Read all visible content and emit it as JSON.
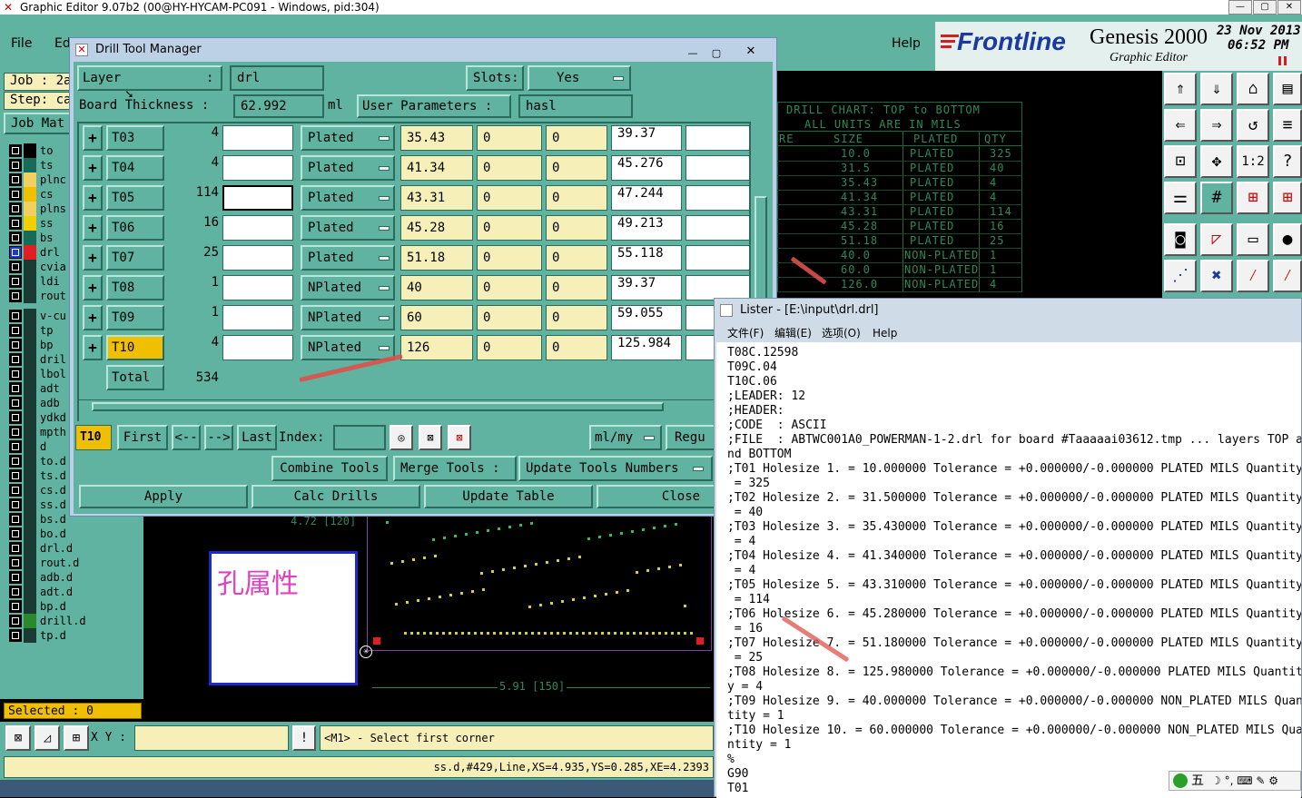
{
  "main_window": {
    "title": "Graphic Editor 9.07b2 (00@HY-HYCAM-PC091 - Windows, pid:304)",
    "menu_file": "File",
    "menu_edit": "Ed",
    "menu_help": "Help",
    "brand": "Frontline",
    "product": "Genesis 2000",
    "subproduct": "Graphic Editor",
    "date": "23 Nov 2013",
    "time": "06:52 PM",
    "job_label": "Job : 2a",
    "step_label": "Step: ca",
    "job_matrix": "Job Mat",
    "selected": "Selected : 0",
    "xy_label": "X Y :",
    "xy_value": "",
    "prompt_btn": "!",
    "prompt": "<M1> - Select first corner",
    "status": "ss.d,#429,Line,XS=4.935,YS=0.285,XE=4.2393"
  },
  "layers": [
    {
      "name": "to",
      "color": "#000000"
    },
    {
      "name": "ts",
      "color": "#1a6a5a"
    },
    {
      "name": "plnc",
      "color": "#f0d060"
    },
    {
      "name": "cs",
      "color": "#f0c000"
    },
    {
      "name": "plns",
      "color": "#f0d060"
    },
    {
      "name": "ss",
      "color": "#f0d000"
    },
    {
      "name": "bs",
      "color": "#1a6a5a"
    },
    {
      "name": "drl",
      "color": "#e02020"
    },
    {
      "name": "cvia",
      "color": "#1a3a34"
    },
    {
      "name": "ldi",
      "color": "#1a3a34"
    },
    {
      "name": "rout",
      "color": "#1a3a34"
    },
    {
      "name": "v-cu",
      "color": "#1a3a34"
    },
    {
      "name": "tp",
      "color": "#1a3a34"
    },
    {
      "name": "bp",
      "color": "#1a3a34"
    },
    {
      "name": "dril",
      "color": "#1a3a34"
    },
    {
      "name": "lbol",
      "color": "#1a3a34"
    },
    {
      "name": "adt",
      "color": "#1a3a34"
    },
    {
      "name": "adb",
      "color": "#1a3a34"
    },
    {
      "name": "ydkd",
      "color": "#1a3a34"
    },
    {
      "name": "mpth",
      "color": "#1a3a34"
    },
    {
      "name": "d",
      "color": "#1a3a34"
    },
    {
      "name": "to.d",
      "color": "#1a3a34"
    },
    {
      "name": "ts.d",
      "color": "#1a3a34"
    },
    {
      "name": "cs.d",
      "color": "#1a3a34"
    },
    {
      "name": "ss.d",
      "color": "#1a3a34"
    },
    {
      "name": "bs.d",
      "color": "#1a3a34"
    },
    {
      "name": "bo.d",
      "color": "#1a3a34"
    },
    {
      "name": "drl.d",
      "color": "#1a3a34"
    },
    {
      "name": "rout.d",
      "color": "#1a3a34"
    },
    {
      "name": "adb.d",
      "color": "#1a3a34"
    },
    {
      "name": "adt.d",
      "color": "#1a3a34"
    },
    {
      "name": "bp.d",
      "color": "#1a3a34"
    },
    {
      "name": "drill.d",
      "color": "#2a8a2a"
    },
    {
      "name": "tp.d",
      "color": "#1a3a34"
    }
  ],
  "dtm": {
    "title": "Drill Tool Manager",
    "layer_label": "Layer",
    "layer_colon": ":",
    "layer_value": "drl",
    "slots_label": "Slots:",
    "slots_value": "Yes",
    "thickness_label": "Board Thickness :",
    "thickness_value": "62.992",
    "thickness_unit": "ml",
    "user_params_label": "User Parameters :",
    "user_params_value": "hasl",
    "rows": [
      {
        "tool": "T03",
        "count": "4",
        "type": "Plated",
        "size": "35.43",
        "a": "0",
        "b": "0",
        "finish": "39.37"
      },
      {
        "tool": "T04",
        "count": "4",
        "type": "Plated",
        "size": "41.34",
        "a": "0",
        "b": "0",
        "finish": "45.276"
      },
      {
        "tool": "T05",
        "count": "114",
        "type": "Plated",
        "size": "43.31",
        "a": "0",
        "b": "0",
        "finish": "47.244"
      },
      {
        "tool": "T06",
        "count": "16",
        "type": "Plated",
        "size": "45.28",
        "a": "0",
        "b": "0",
        "finish": "49.213"
      },
      {
        "tool": "T07",
        "count": "25",
        "type": "Plated",
        "size": "51.18",
        "a": "0",
        "b": "0",
        "finish": "55.118"
      },
      {
        "tool": "T08",
        "count": "1",
        "type": "NPlated",
        "size": "40",
        "a": "0",
        "b": "0",
        "finish": "39.37"
      },
      {
        "tool": "T09",
        "count": "1",
        "type": "NPlated",
        "size": "60",
        "a": "0",
        "b": "0",
        "finish": "59.055"
      },
      {
        "tool": "T10",
        "count": "4",
        "type": "NPlated",
        "size": "126",
        "a": "0",
        "b": "0",
        "finish": "125.984"
      }
    ],
    "total_label": "Total",
    "total_value": "534",
    "current_tool": "T10",
    "first": "First",
    "prev": "<--",
    "next": "-->",
    "last": "Last",
    "index_label": "Index:",
    "units": "ml/my",
    "regular": "Regu",
    "combine": "Combine Tools",
    "merge": "Merge Tools :",
    "update_numbers": "Update Tools Numbers",
    "apply": "Apply",
    "calc": "Calc Drills",
    "update_table": "Update Table",
    "close": "Close"
  },
  "canvas": {
    "annotation": "孔属性",
    "dim_top": "4.72 [120]",
    "dim_bottom": "5.91 [150]"
  },
  "drill_chart": {
    "title": "DRILL CHART: TOP to BOTTOM",
    "subtitle": "ALL UNITS ARE IN MILS",
    "col0": "RE",
    "col_size": "SIZE",
    "col_plated": "PLATED",
    "col_qty": "QTY",
    "rows": [
      {
        "size": "10.0",
        "plated": "PLATED",
        "qty": "325"
      },
      {
        "size": "31.5",
        "plated": "PLATED",
        "qty": "40"
      },
      {
        "size": "35.43",
        "plated": "PLATED",
        "qty": "4"
      },
      {
        "size": "41.34",
        "plated": "PLATED",
        "qty": "4"
      },
      {
        "size": "43.31",
        "plated": "PLATED",
        "qty": "114"
      },
      {
        "size": "45.28",
        "plated": "PLATED",
        "qty": "16"
      },
      {
        "size": "51.18",
        "plated": "PLATED",
        "qty": "25"
      },
      {
        "size": "40.0",
        "plated": "NON-PLATED",
        "qty": "1"
      },
      {
        "size": "60.0",
        "plated": "NON-PLATED",
        "qty": "1"
      },
      {
        "size": "126.0",
        "plated": "NON-PLATED",
        "qty": "4"
      }
    ]
  },
  "lister": {
    "title": "Lister - [E:\\input\\drl.drl]",
    "menu": [
      "文件(F)",
      "编辑(E)",
      "选项(O)",
      "Help"
    ],
    "lines": [
      "T08C.12598",
      "T09C.04",
      "T10C.06",
      ";LEADER: 12",
      ";HEADER:",
      ";CODE  : ASCII",
      ";FILE  : ABTWC001A0_POWERMAN-1-2.drl for board #Taaaaai03612.tmp ... layers TOP a",
      "nd BOTTOM",
      ";T01 Holesize 1. = 10.000000 Tolerance = +0.000000/-0.000000 PLATED MILS Quantity",
      " = 325",
      ";T02 Holesize 2. = 31.500000 Tolerance = +0.000000/-0.000000 PLATED MILS Quantity",
      " = 40",
      ";T03 Holesize 3. = 35.430000 Tolerance = +0.000000/-0.000000 PLATED MILS Quantity",
      " = 4",
      ";T04 Holesize 4. = 41.340000 Tolerance = +0.000000/-0.000000 PLATED MILS Quantity",
      " = 4",
      ";T05 Holesize 5. = 43.310000 Tolerance = +0.000000/-0.000000 PLATED MILS Quantity",
      " = 114",
      ";T06 Holesize 6. = 45.280000 Tolerance = +0.000000/-0.000000 PLATED MILS Quantity",
      " = 16",
      ";T07 Holesize 7. = 51.180000 Tolerance = +0.000000/-0.000000 PLATED MILS Quantity",
      " = 25",
      ";T08 Holesize 8. = 125.980000 Tolerance = +0.000000/-0.000000 PLATED MILS Quantit",
      "y = 4",
      ";T09 Holesize 9. = 40.000000 Tolerance = +0.000000/-0.000000 NON_PLATED MILS Quan",
      "tity = 1",
      ";T10 Holesize 10. = 60.000000 Tolerance = +0.000000/-0.000000 NON_PLATED MILS Qua",
      "ntity = 1",
      "%",
      "G90",
      "T01"
    ],
    "ime": "五"
  }
}
